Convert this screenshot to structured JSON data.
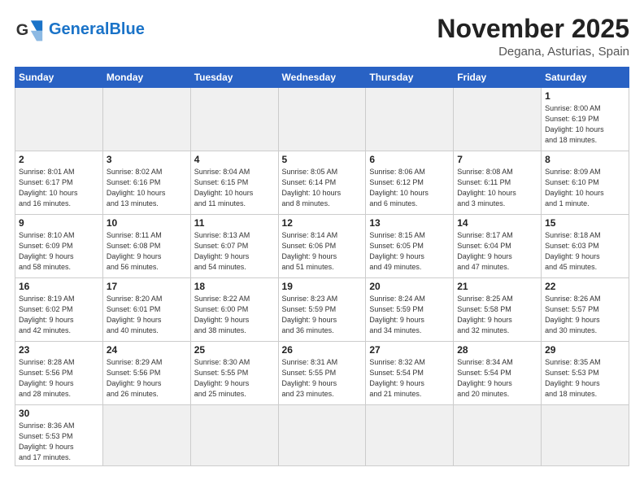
{
  "header": {
    "logo_general": "General",
    "logo_blue": "Blue",
    "title": "November 2025",
    "subtitle": "Degana, Asturias, Spain"
  },
  "weekdays": [
    "Sunday",
    "Monday",
    "Tuesday",
    "Wednesday",
    "Thursday",
    "Friday",
    "Saturday"
  ],
  "weeks": [
    [
      {
        "day": "",
        "info": "",
        "empty": true
      },
      {
        "day": "",
        "info": "",
        "empty": true
      },
      {
        "day": "",
        "info": "",
        "empty": true
      },
      {
        "day": "",
        "info": "",
        "empty": true
      },
      {
        "day": "",
        "info": "",
        "empty": true
      },
      {
        "day": "",
        "info": "",
        "empty": true
      },
      {
        "day": "1",
        "info": "Sunrise: 8:00 AM\nSunset: 6:19 PM\nDaylight: 10 hours\nand 18 minutes."
      }
    ],
    [
      {
        "day": "2",
        "info": "Sunrise: 8:01 AM\nSunset: 6:17 PM\nDaylight: 10 hours\nand 16 minutes."
      },
      {
        "day": "3",
        "info": "Sunrise: 8:02 AM\nSunset: 6:16 PM\nDaylight: 10 hours\nand 13 minutes."
      },
      {
        "day": "4",
        "info": "Sunrise: 8:04 AM\nSunset: 6:15 PM\nDaylight: 10 hours\nand 11 minutes."
      },
      {
        "day": "5",
        "info": "Sunrise: 8:05 AM\nSunset: 6:14 PM\nDaylight: 10 hours\nand 8 minutes."
      },
      {
        "day": "6",
        "info": "Sunrise: 8:06 AM\nSunset: 6:12 PM\nDaylight: 10 hours\nand 6 minutes."
      },
      {
        "day": "7",
        "info": "Sunrise: 8:08 AM\nSunset: 6:11 PM\nDaylight: 10 hours\nand 3 minutes."
      },
      {
        "day": "8",
        "info": "Sunrise: 8:09 AM\nSunset: 6:10 PM\nDaylight: 10 hours\nand 1 minute."
      }
    ],
    [
      {
        "day": "9",
        "info": "Sunrise: 8:10 AM\nSunset: 6:09 PM\nDaylight: 9 hours\nand 58 minutes."
      },
      {
        "day": "10",
        "info": "Sunrise: 8:11 AM\nSunset: 6:08 PM\nDaylight: 9 hours\nand 56 minutes."
      },
      {
        "day": "11",
        "info": "Sunrise: 8:13 AM\nSunset: 6:07 PM\nDaylight: 9 hours\nand 54 minutes."
      },
      {
        "day": "12",
        "info": "Sunrise: 8:14 AM\nSunset: 6:06 PM\nDaylight: 9 hours\nand 51 minutes."
      },
      {
        "day": "13",
        "info": "Sunrise: 8:15 AM\nSunset: 6:05 PM\nDaylight: 9 hours\nand 49 minutes."
      },
      {
        "day": "14",
        "info": "Sunrise: 8:17 AM\nSunset: 6:04 PM\nDaylight: 9 hours\nand 47 minutes."
      },
      {
        "day": "15",
        "info": "Sunrise: 8:18 AM\nSunset: 6:03 PM\nDaylight: 9 hours\nand 45 minutes."
      }
    ],
    [
      {
        "day": "16",
        "info": "Sunrise: 8:19 AM\nSunset: 6:02 PM\nDaylight: 9 hours\nand 42 minutes."
      },
      {
        "day": "17",
        "info": "Sunrise: 8:20 AM\nSunset: 6:01 PM\nDaylight: 9 hours\nand 40 minutes."
      },
      {
        "day": "18",
        "info": "Sunrise: 8:22 AM\nSunset: 6:00 PM\nDaylight: 9 hours\nand 38 minutes."
      },
      {
        "day": "19",
        "info": "Sunrise: 8:23 AM\nSunset: 5:59 PM\nDaylight: 9 hours\nand 36 minutes."
      },
      {
        "day": "20",
        "info": "Sunrise: 8:24 AM\nSunset: 5:59 PM\nDaylight: 9 hours\nand 34 minutes."
      },
      {
        "day": "21",
        "info": "Sunrise: 8:25 AM\nSunset: 5:58 PM\nDaylight: 9 hours\nand 32 minutes."
      },
      {
        "day": "22",
        "info": "Sunrise: 8:26 AM\nSunset: 5:57 PM\nDaylight: 9 hours\nand 30 minutes."
      }
    ],
    [
      {
        "day": "23",
        "info": "Sunrise: 8:28 AM\nSunset: 5:56 PM\nDaylight: 9 hours\nand 28 minutes."
      },
      {
        "day": "24",
        "info": "Sunrise: 8:29 AM\nSunset: 5:56 PM\nDaylight: 9 hours\nand 26 minutes."
      },
      {
        "day": "25",
        "info": "Sunrise: 8:30 AM\nSunset: 5:55 PM\nDaylight: 9 hours\nand 25 minutes."
      },
      {
        "day": "26",
        "info": "Sunrise: 8:31 AM\nSunset: 5:55 PM\nDaylight: 9 hours\nand 23 minutes."
      },
      {
        "day": "27",
        "info": "Sunrise: 8:32 AM\nSunset: 5:54 PM\nDaylight: 9 hours\nand 21 minutes."
      },
      {
        "day": "28",
        "info": "Sunrise: 8:34 AM\nSunset: 5:54 PM\nDaylight: 9 hours\nand 20 minutes."
      },
      {
        "day": "29",
        "info": "Sunrise: 8:35 AM\nSunset: 5:53 PM\nDaylight: 9 hours\nand 18 minutes."
      }
    ],
    [
      {
        "day": "30",
        "info": "Sunrise: 8:36 AM\nSunset: 5:53 PM\nDaylight: 9 hours\nand 17 minutes.",
        "lastrow": true
      },
      {
        "day": "",
        "info": "",
        "empty": true,
        "lastrow": true
      },
      {
        "day": "",
        "info": "",
        "empty": true,
        "lastrow": true
      },
      {
        "day": "",
        "info": "",
        "empty": true,
        "lastrow": true
      },
      {
        "day": "",
        "info": "",
        "empty": true,
        "lastrow": true
      },
      {
        "day": "",
        "info": "",
        "empty": true,
        "lastrow": true
      },
      {
        "day": "",
        "info": "",
        "empty": true,
        "lastrow": true
      }
    ]
  ]
}
